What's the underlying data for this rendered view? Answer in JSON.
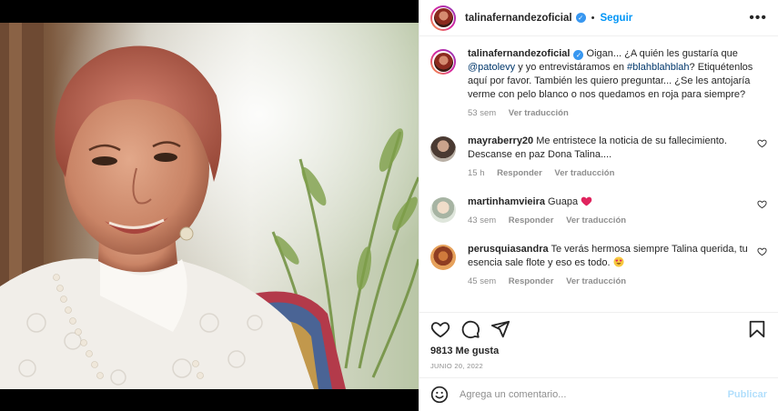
{
  "header": {
    "username": "talinafernandezoficial",
    "separator": "•",
    "follow_label": "Seguir",
    "more_icon": "more-horizontal-icon"
  },
  "caption": {
    "username": "talinafernandezoficial",
    "text_before_mention": " Oigan... ¿A quién les gustaría que ",
    "mention": "@patolevy",
    "text_middle": " y yo entrevistáramos en ",
    "hashtag": "#blahblahblah",
    "text_after": "? Etiquétenlos aquí por favor. También les quiero preguntar... ¿Se les antojaría verme con pelo blanco o nos quedamos en roja para siempre?",
    "time": "53 sem",
    "translate_label": "Ver traducción"
  },
  "comments": [
    {
      "username": "mayraberry20",
      "text": " Me entristece la noticia de su fallecimiento. Descanse en paz Dona Talina....",
      "time": "15 h",
      "reply_label": "Responder",
      "translate_label": "Ver traducción"
    },
    {
      "username": "martinhamvieira",
      "text": " Guapa",
      "emoji": "red-heart",
      "time": "43 sem",
      "reply_label": "Responder",
      "translate_label": "Ver traducción"
    },
    {
      "username": "perusquiasandra",
      "text": " Te verás hermosa siempre Talina querida, tu esencia sale flote y eso es todo.",
      "emoji": "heart-eyes",
      "time": "45 sem",
      "reply_label": "Responder",
      "translate_label": "Ver traducción"
    }
  ],
  "actions": {
    "icons": [
      "heart-icon",
      "comment-icon",
      "share-icon",
      "bookmark-icon"
    ]
  },
  "likes": "9813 Me gusta",
  "date": "JUNIO 20, 2022",
  "comment_box": {
    "placeholder": "Agrega un comentario...",
    "publish_label": "Publicar"
  },
  "colors": {
    "accent": "#0095f6",
    "verified": "#3897f0",
    "muted": "#8e8e8e",
    "text": "#262626",
    "publish_disabled": "#b2dffc"
  }
}
